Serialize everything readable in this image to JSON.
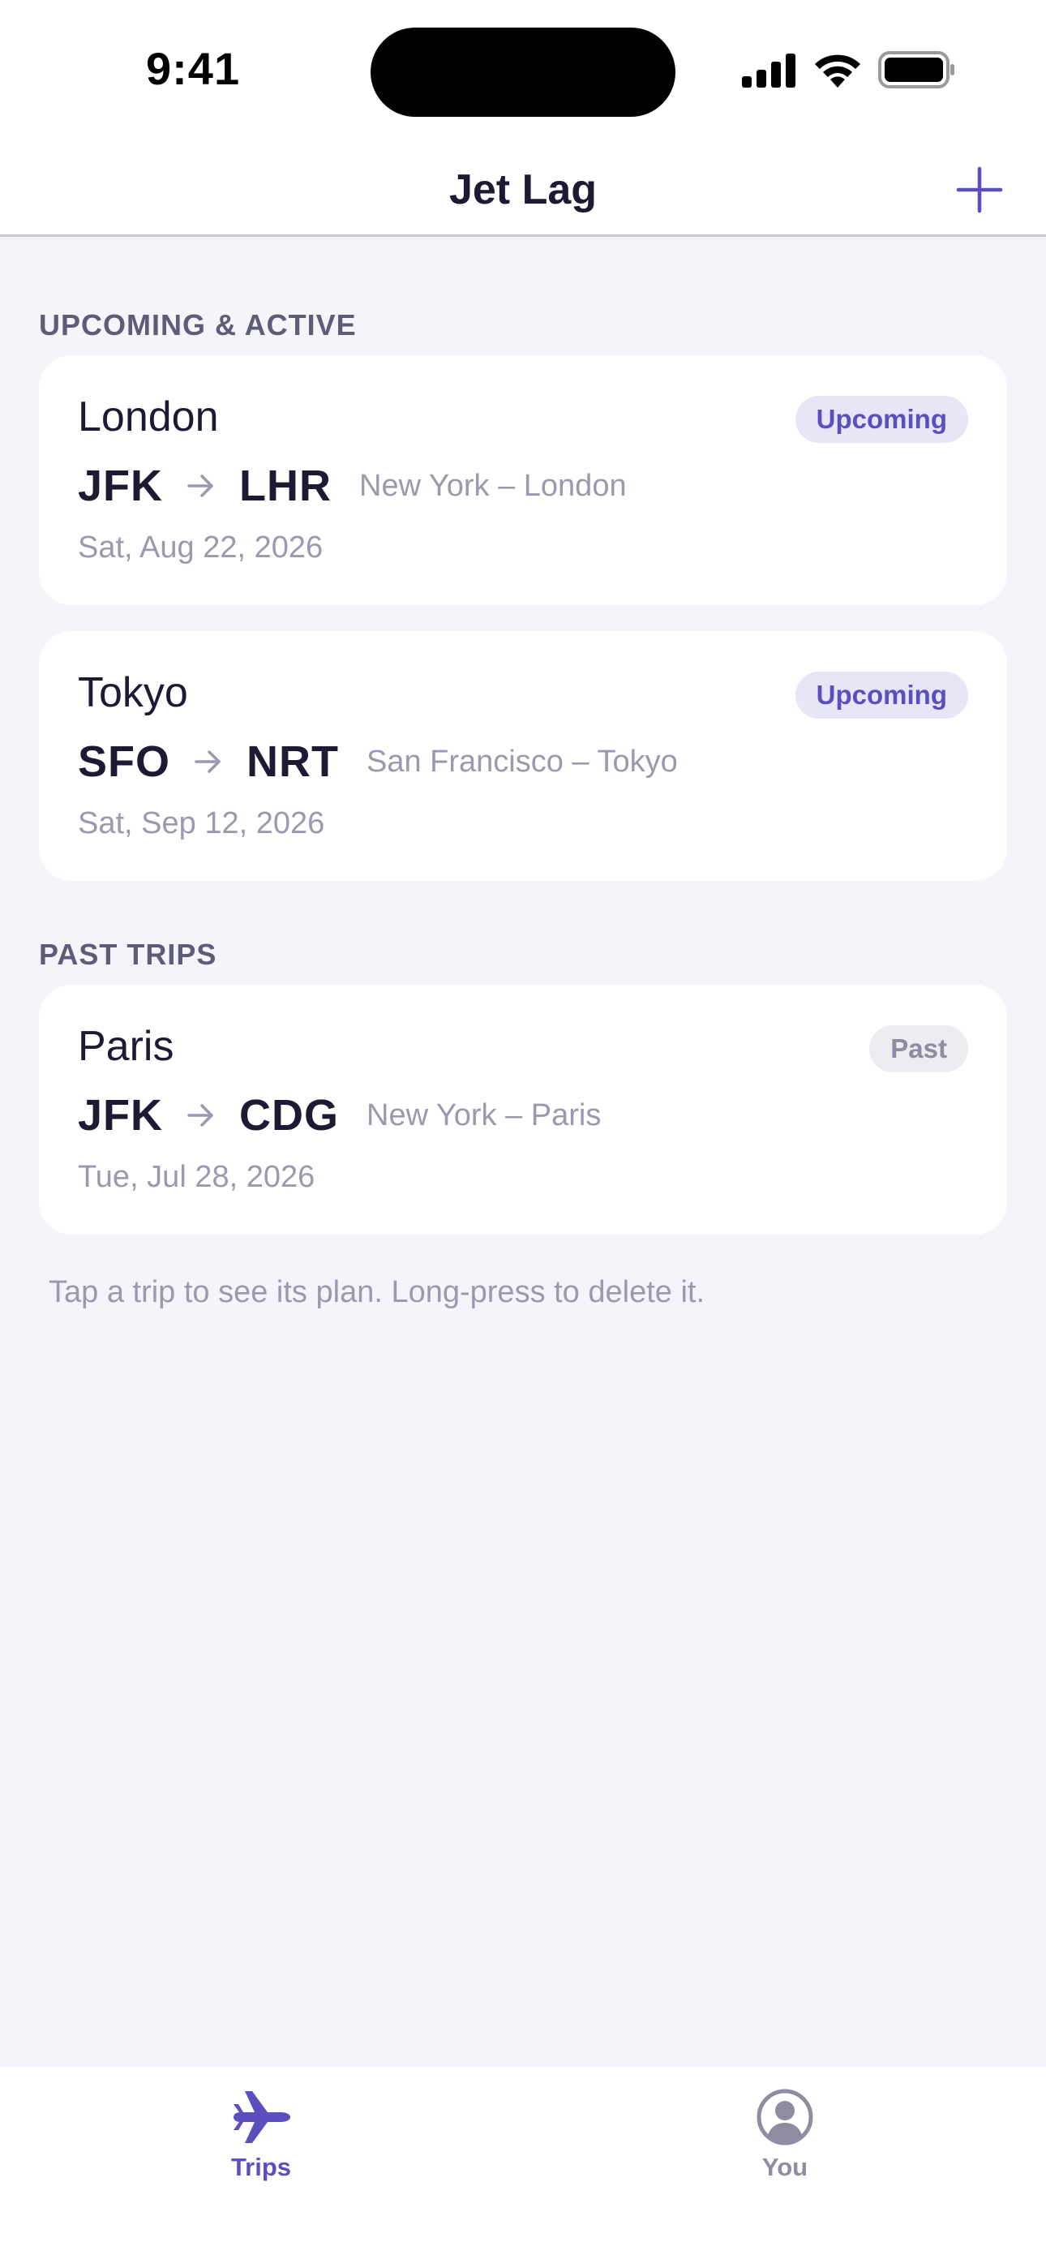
{
  "status_bar": {
    "time": "9:41"
  },
  "header": {
    "title": "Jet Lag",
    "add_icon": "plus-icon"
  },
  "sections": {
    "upcoming_label": "UPCOMING & ACTIVE",
    "past_label": "PAST TRIPS"
  },
  "trips": [
    {
      "name": "London",
      "status": "Upcoming",
      "from": "JFK",
      "to": "LHR",
      "cities": "New York – London",
      "date": "Sat, Aug 22, 2026"
    },
    {
      "name": "Tokyo",
      "status": "Upcoming",
      "from": "SFO",
      "to": "NRT",
      "cities": "San Francisco – Tokyo",
      "date": "Sat, Sep 12, 2026"
    },
    {
      "name": "Paris",
      "status": "Past",
      "from": "JFK",
      "to": "CDG",
      "cities": "New York – Paris",
      "date": "Tue, Jul 28, 2026"
    }
  ],
  "hint": "Tap a trip to see its plan. Long-press to delete it.",
  "tabs": [
    {
      "label": "Trips",
      "icon": "airplane-icon",
      "active": true
    },
    {
      "label": "You",
      "icon": "person-circle-icon",
      "active": false
    }
  ],
  "colors": {
    "accent": "#5B4FC0",
    "background": "#F4F4FA",
    "text_primary": "#1C1B33",
    "text_secondary": "#9A99AE",
    "inactive_tab": "#8D8CA0"
  }
}
